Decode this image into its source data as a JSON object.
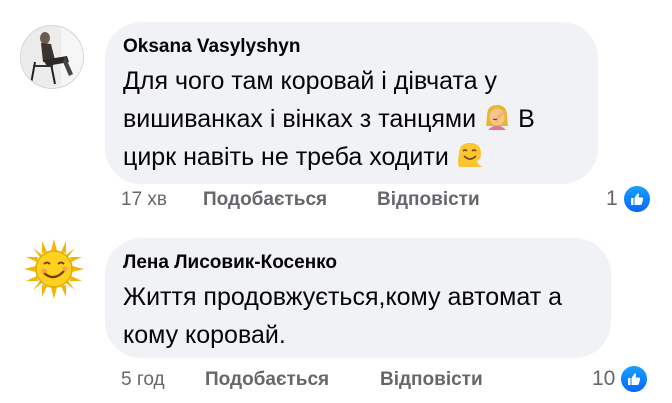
{
  "comments": [
    {
      "author": "Oksana Vasylyshyn",
      "text_lines": [
        "Для чого там коровай і дівчата у",
        "вишиванках і вінках з танцями",
        "В",
        "цирк навіть не треба ходити"
      ],
      "emojis": [
        "woman-facepalming-emoji",
        "melting-face-emoji"
      ],
      "time": "17 хв",
      "like_label": "Подобається",
      "reply_label": "Відповісти",
      "reaction_count": "1",
      "reaction_icon": "like-icon",
      "avatar": "photo-avatar"
    },
    {
      "author": "Лена Лисовик-Косенко",
      "text_lines": [
        "Життя продовжується,кому автомат а",
        "кому коровай."
      ],
      "emojis": [],
      "time": "5 год",
      "like_label": "Подобається",
      "reply_label": "Відповісти",
      "reaction_count": "10",
      "reaction_icon": "like-icon",
      "avatar": "sun-avatar"
    }
  ],
  "colors": {
    "bubble_bg": "#f0f2f5",
    "meta_text": "#65676b",
    "like_blue": "#0866ff"
  }
}
